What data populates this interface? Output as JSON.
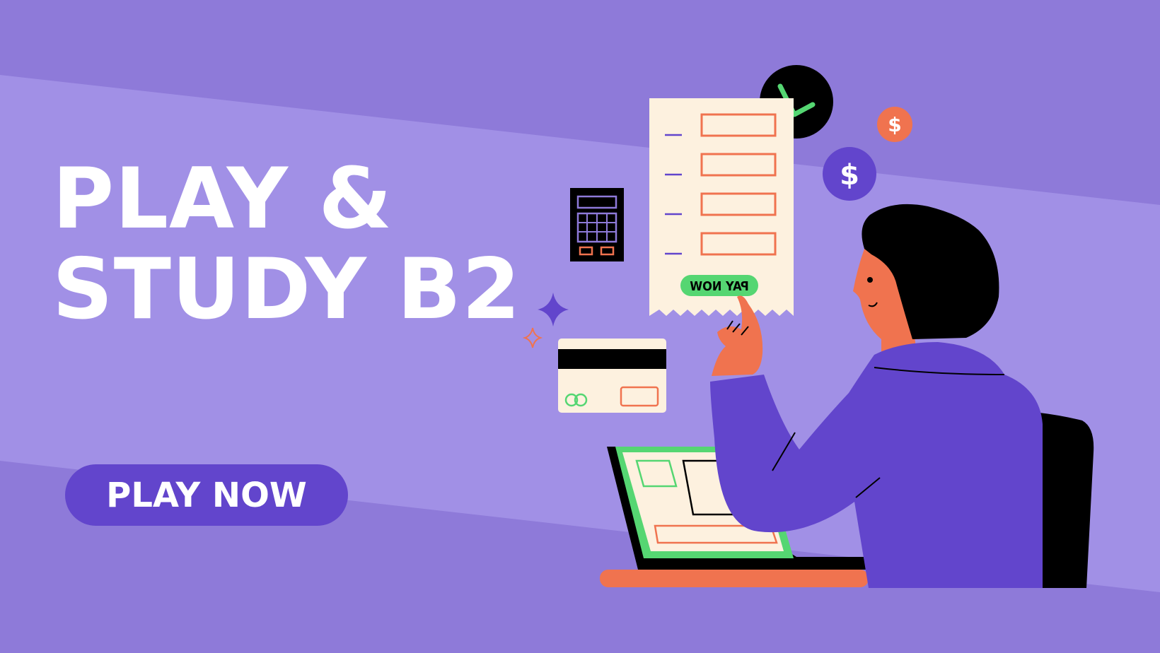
{
  "headline": {
    "line1": "PLAY &",
    "line2": "STUDY B2"
  },
  "cta": {
    "label": "PLAY NOW"
  },
  "receipt": {
    "pay_button_label": "PAY NOW"
  },
  "icons": {
    "coin": "dollar-coin-icon",
    "check": "checkmark-icon",
    "calculator": "calculator-icon",
    "card": "credit-card-icon",
    "sparkle": "sparkle-icon"
  },
  "colors": {
    "background": "#8e7ad9",
    "band": "#a190e6",
    "accent": "#6245cc",
    "orange": "#f0734f",
    "green": "#55d672",
    "cream": "#fdf1df"
  }
}
